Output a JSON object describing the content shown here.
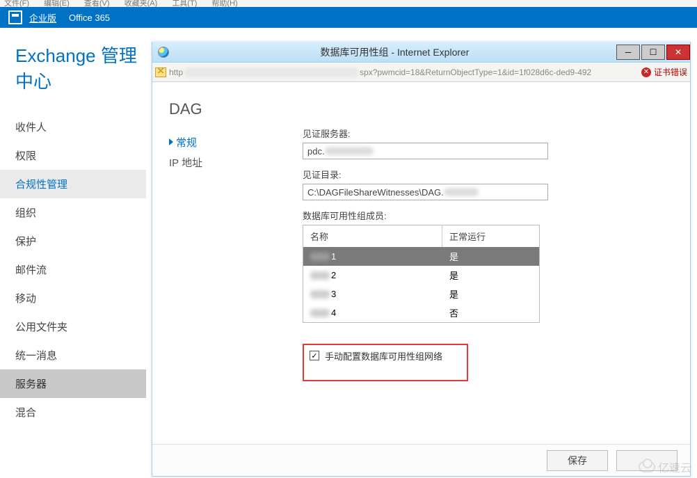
{
  "topmenu": [
    "文件(F)",
    "编辑(E)",
    "查看(V)",
    "收藏夹(A)",
    "工具(T)",
    "帮助(H)"
  ],
  "bluebar": {
    "enterprise": "企业版",
    "product": "Office 365"
  },
  "eca_title": "Exchange 管理中心",
  "nav": [
    {
      "label": "收件人",
      "state": ""
    },
    {
      "label": "权限",
      "state": ""
    },
    {
      "label": "合规性管理",
      "state": "selected"
    },
    {
      "label": "组织",
      "state": ""
    },
    {
      "label": "保护",
      "state": ""
    },
    {
      "label": "邮件流",
      "state": ""
    },
    {
      "label": "移动",
      "state": ""
    },
    {
      "label": "公用文件夹",
      "state": ""
    },
    {
      "label": "统一消息",
      "state": ""
    },
    {
      "label": "服务器",
      "state": "active"
    },
    {
      "label": "混合",
      "state": ""
    }
  ],
  "popup": {
    "title": "数据库可用性组 - Internet Explorer",
    "url_prefix": "http",
    "url_tail": "spx?pwmcid=18&ReturnObjectType=1&id=1f028d6c-ded9-492",
    "cert_error": "证书错误",
    "heading": "DAG",
    "side": {
      "general": "常规",
      "ip": "IP 地址"
    },
    "witness_server_label": "见证服务器:",
    "witness_server_value": "pdc.",
    "witness_dir_label": "见证目录:",
    "witness_dir_value": "C:\\DAGFileShareWitnesses\\DAG.",
    "members_label": "数据库可用性组成员:",
    "members_headers": {
      "name": "名称",
      "running": "正常运行"
    },
    "members": [
      {
        "suffix": "1",
        "running": "是",
        "selected": true
      },
      {
        "suffix": "2",
        "running": "是",
        "selected": false
      },
      {
        "suffix": "3",
        "running": "是",
        "selected": false
      },
      {
        "suffix": "4",
        "running": "否",
        "selected": false
      }
    ],
    "checkbox_label": "手动配置数据库可用性组网络",
    "checkbox_checked": true,
    "save": "保存",
    "cancel": ""
  },
  "watermark": "亿速云"
}
